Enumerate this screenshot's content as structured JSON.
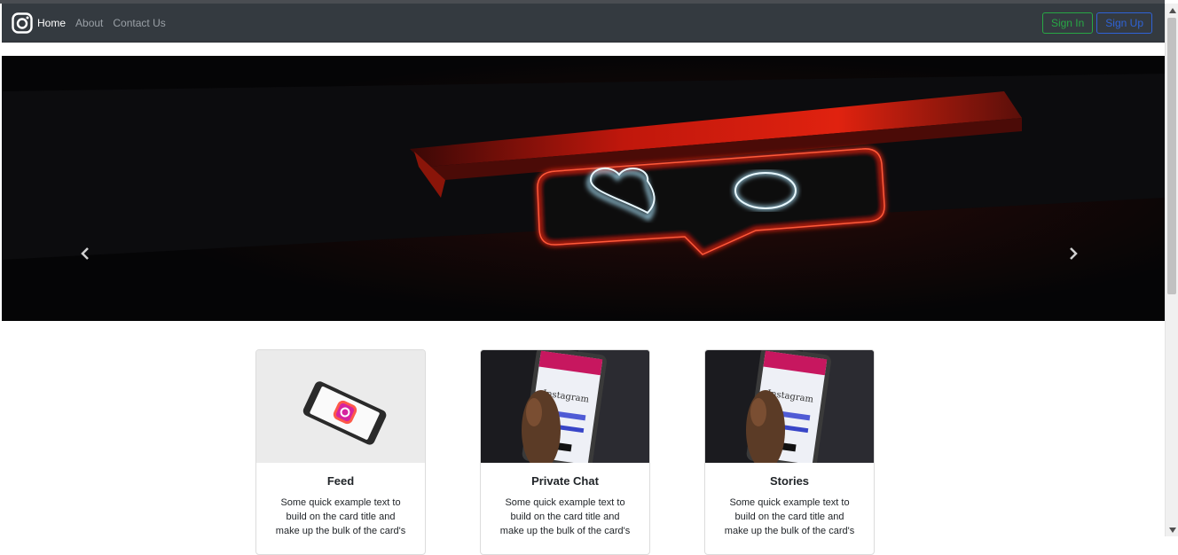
{
  "navbar": {
    "brand_icon": "instagram-logo-icon",
    "links": [
      {
        "label": "Home"
      },
      {
        "label": "About"
      },
      {
        "label": "Contact Us"
      }
    ],
    "signin_label": "Sign In",
    "signup_label": "Sign Up"
  },
  "hero": {
    "image": "neon-like-sign-photo",
    "prev_icon": "chevron-left-icon",
    "next_icon": "chevron-right-icon"
  },
  "cards": [
    {
      "title": "Feed",
      "text": "Some quick example text to build on the card title and make up the bulk of the card's",
      "image": "phone-on-table-instagram-logo"
    },
    {
      "title": "Private Chat",
      "text": "Some quick example text to build on the card title and make up the bulk of the card's",
      "image": "hand-holding-phone-instagram-login"
    },
    {
      "title": "Stories",
      "text": "Some quick example text to build on the card title and make up the bulk of the card's",
      "image": "hand-holding-phone-instagram-login"
    }
  ],
  "colors": {
    "navbar_bg": "#343a40",
    "signin": "#28a745",
    "signup": "#2f63d6"
  }
}
